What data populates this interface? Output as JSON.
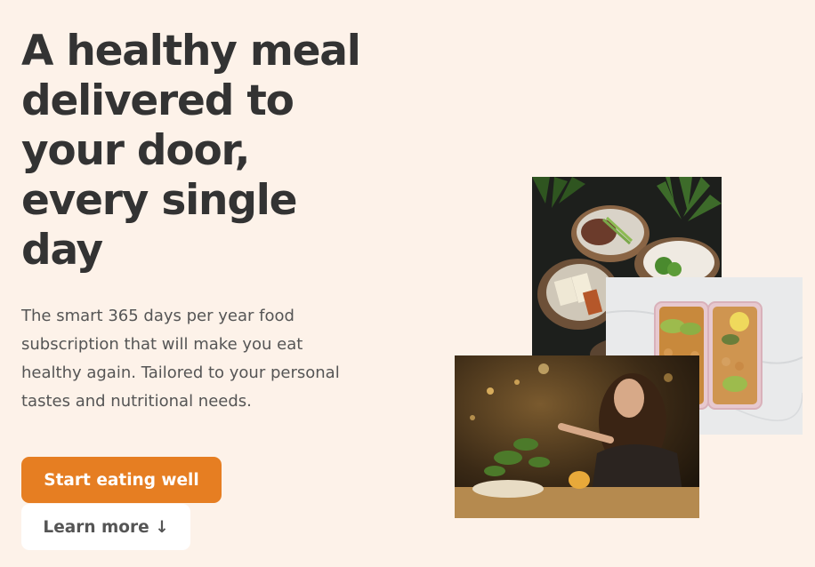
{
  "hero": {
    "title_lines": [
      "A healthy meal",
      "delivered to",
      "your door,",
      "every single",
      "day"
    ],
    "description": "The smart 365 days per year food subscription that will make you eat healthy again. Tailored to your personal tastes and nutritional needs.",
    "primary_button": "Start eating well",
    "secondary_button": "Learn more ↓"
  },
  "images": [
    {
      "name": "food-bowls-photo",
      "depicts": "dark table with rice and meat bowls and plants"
    },
    {
      "name": "meal-prep-containers-photo",
      "depicts": "pink lunch boxes with chickpeas, avocado and lemon on marble"
    },
    {
      "name": "woman-eating-photo",
      "depicts": "woman with long hair eating at a restaurant table"
    }
  ],
  "colors": {
    "background": "#fdf2e9",
    "accent": "#e67e22",
    "text": "#333333",
    "muted_text": "#555555"
  }
}
